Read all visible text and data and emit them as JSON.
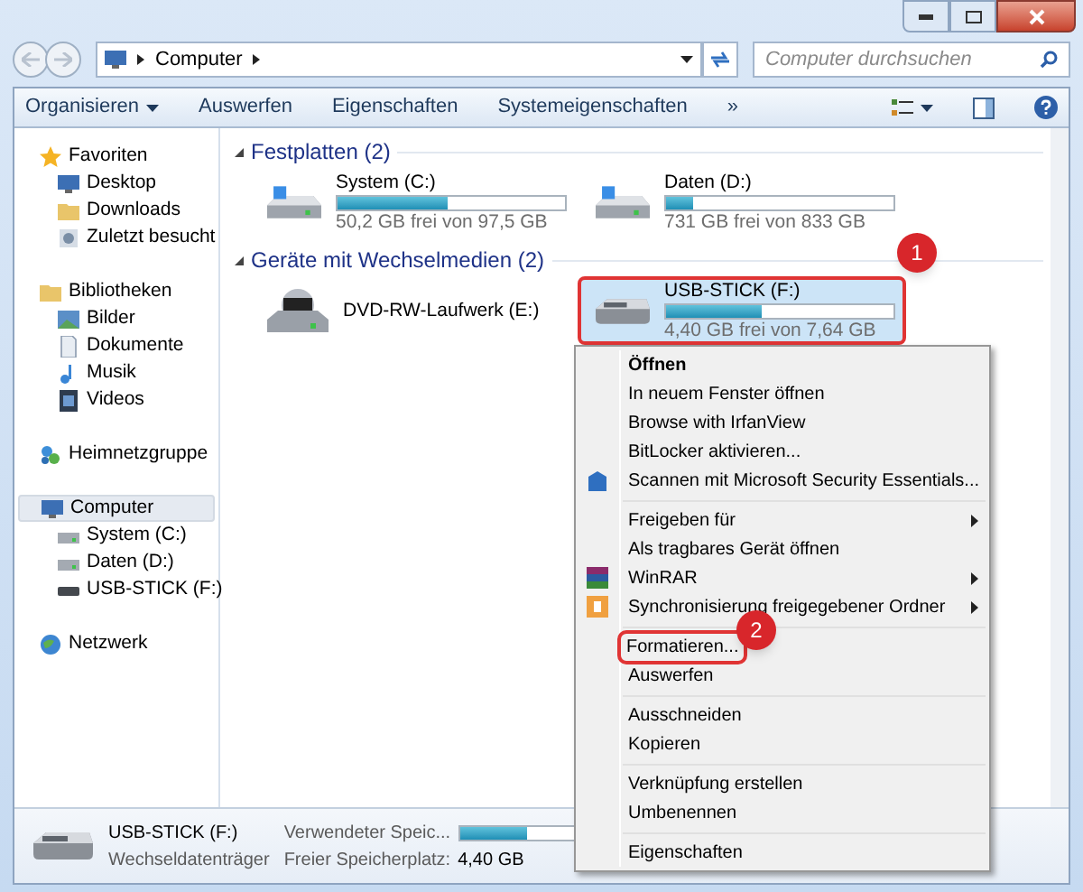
{
  "address": {
    "path": [
      "Computer"
    ]
  },
  "search": {
    "placeholder": "Computer durchsuchen"
  },
  "toolbar": [
    {
      "label": "Organisieren",
      "dropdown": true
    },
    {
      "label": "Auswerfen",
      "dropdown": false
    },
    {
      "label": "Eigenschaften",
      "dropdown": false
    },
    {
      "label": "Systemeigenschaften",
      "dropdown": false
    },
    {
      "label": "»",
      "dropdown": false
    }
  ],
  "sidebar": {
    "groups": [
      {
        "label": "Favoriten",
        "selected": false,
        "children": [
          {
            "label": "Desktop",
            "selected": false
          },
          {
            "label": "Downloads",
            "selected": false
          },
          {
            "label": "Zuletzt besucht",
            "selected": false
          }
        ]
      },
      {
        "label": "Bibliotheken",
        "selected": false,
        "children": [
          {
            "label": "Bilder",
            "selected": false
          },
          {
            "label": "Dokumente",
            "selected": false
          },
          {
            "label": "Musik",
            "selected": false
          },
          {
            "label": "Videos",
            "selected": false
          }
        ]
      },
      {
        "label": "Heimnetzgruppe",
        "selected": false
      },
      {
        "label": "Computer",
        "selected": true,
        "children": [
          {
            "label": "System (C:)",
            "selected": false
          },
          {
            "label": "Daten (D:)",
            "selected": false
          },
          {
            "label": "USB-STICK (F:)",
            "selected": false
          }
        ]
      },
      {
        "label": "Netzwerk",
        "selected": false
      }
    ]
  },
  "sections": [
    {
      "title": "Festplatten (2)",
      "drives": [
        {
          "kind": "disk",
          "name": "System (C:)",
          "level": 0.485,
          "free": "50,2 GB frei von 97,5 GB",
          "selected": false
        },
        {
          "kind": "disk",
          "name": "Daten (D:)",
          "level": 0.12,
          "free": "731 GB frei von 833 GB",
          "selected": false
        }
      ]
    },
    {
      "title": "Geräte mit Wechselmedien (2)",
      "drives": [
        {
          "kind": "optical",
          "name": "DVD-RW-Laufwerk (E:)",
          "selected": false
        },
        {
          "kind": "usb",
          "name": "USB-STICK (F:)",
          "level": 0.42,
          "free": "4,40 GB frei von 7,64 GB",
          "selected": true
        }
      ]
    }
  ],
  "context_menu": [
    {
      "kind": "item",
      "label": "Öffnen",
      "default": true,
      "submenu": false,
      "highlighted": false
    },
    {
      "kind": "item",
      "label": "In neuem Fenster öffnen",
      "default": false,
      "submenu": false,
      "highlighted": false
    },
    {
      "kind": "item",
      "label": "Browse with IrfanView",
      "default": false,
      "submenu": false,
      "highlighted": false
    },
    {
      "kind": "item",
      "label": "BitLocker aktivieren...",
      "default": false,
      "submenu": false,
      "highlighted": false
    },
    {
      "kind": "item",
      "label": "Scannen mit Microsoft Security Essentials...",
      "default": false,
      "submenu": false,
      "highlighted": false
    },
    {
      "kind": "separator"
    },
    {
      "kind": "item",
      "label": "Freigeben für",
      "default": false,
      "submenu": true,
      "highlighted": false
    },
    {
      "kind": "item",
      "label": "Als tragbares Gerät öffnen",
      "default": false,
      "submenu": false,
      "highlighted": false
    },
    {
      "kind": "item",
      "label": "WinRAR",
      "default": false,
      "submenu": true,
      "highlighted": false
    },
    {
      "kind": "item",
      "label": "Synchronisierung freigegebener Ordner",
      "default": false,
      "submenu": true,
      "highlighted": false
    },
    {
      "kind": "separator"
    },
    {
      "kind": "item",
      "label": "Formatieren...",
      "default": false,
      "submenu": false,
      "highlighted": true
    },
    {
      "kind": "item",
      "label": "Auswerfen",
      "default": false,
      "submenu": false,
      "highlighted": false
    },
    {
      "kind": "separator"
    },
    {
      "kind": "item",
      "label": "Ausschneiden",
      "default": false,
      "submenu": false,
      "highlighted": false
    },
    {
      "kind": "item",
      "label": "Kopieren",
      "default": false,
      "submenu": false,
      "highlighted": false
    },
    {
      "kind": "separator"
    },
    {
      "kind": "item",
      "label": "Verknüpfung erstellen",
      "default": false,
      "submenu": false,
      "highlighted": false
    },
    {
      "kind": "item",
      "label": "Umbenennen",
      "default": false,
      "submenu": false,
      "highlighted": false
    },
    {
      "kind": "separator"
    },
    {
      "kind": "item",
      "label": "Eigenschaften",
      "default": false,
      "submenu": false,
      "highlighted": false
    }
  ],
  "callouts": [
    "1",
    "2"
  ],
  "details": {
    "name": "USB-STICK (F:)",
    "type": "Wechseldatenträger",
    "used_label": "Verwendeter Speic...",
    "level": 0.42,
    "free_label": "Freier Speicherplatz:",
    "free_value": "4,40 GB"
  }
}
